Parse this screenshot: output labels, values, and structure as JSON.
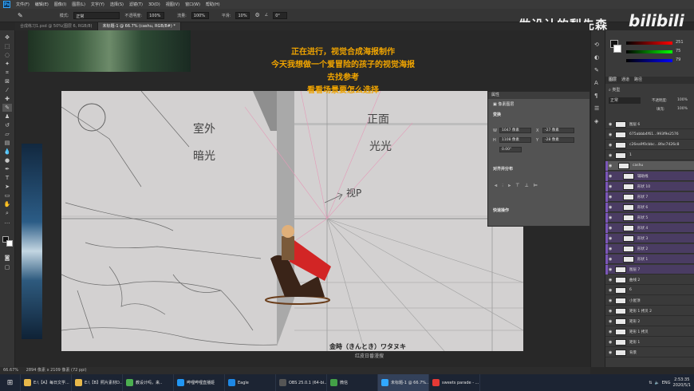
{
  "app": {
    "menu": [
      "文件(F)",
      "编辑(E)",
      "图像(I)",
      "图层(L)",
      "文字(Y)",
      "选择(S)",
      "滤镜(T)",
      "3D(D)",
      "视图(V)",
      "窗口(W)",
      "帮助(H)"
    ],
    "logo": "Ps"
  },
  "options_bar": {
    "mode_label": "模式:",
    "mode_value": "正常",
    "opacity_label": "不透明度:",
    "opacity_value": "100%",
    "flow_label": "流量:",
    "flow_value": "100%",
    "smooth_label": "平滑:",
    "smooth_value": "10%",
    "angle_value": "0°"
  },
  "tabs": [
    {
      "label": "合成练习1.psd @ 50%(图层 6, RGB/8)",
      "active": false
    },
    {
      "label": "未标题-1 @ 66.7% (cashu, RGB/8#) *",
      "active": true
    }
  ],
  "watermark": {
    "text": "做设计的梨先森",
    "logo": "bilibili"
  },
  "overlay_text": [
    "正在进行，视觉合成海报制作",
    "今天我想做一个爱冒险的孩子的视觉海报",
    "去找参考",
    "看看场景要怎么选择"
  ],
  "canvas": {
    "sketch_labels": [
      "室外",
      "暗光",
      "正面",
      "光光",
      "视P"
    ],
    "caption": "金時（きんとき）ワタヌキ",
    "caption_sub": "红皮日番漫搜"
  },
  "properties_panel": {
    "title": "属性",
    "layer_type": "像素图层",
    "transform_label": "变换",
    "w_label": "W",
    "w_value": "1047 像素",
    "x_label": "X",
    "x_value": "-27 像素",
    "h_label": "H",
    "h_value": "1108 像素",
    "y_label": "Y",
    "y_value": "-28 像素",
    "angle_value": "0.00°",
    "align_label": "对齐并分布",
    "quick_actions_label": "快速操作"
  },
  "color_panel": {
    "r_value": "251",
    "g_value": "75",
    "b_value": "79"
  },
  "layers_panel": {
    "tabs": [
      "图层",
      "通道",
      "路径"
    ],
    "kind_label": "类型",
    "blend_mode": "正常",
    "opacity_label": "不透明度:",
    "opacity_value": "100%",
    "fill_label": "填充:",
    "fill_value": "100%",
    "layers": [
      {
        "name": "图层 6",
        "selected": false
      },
      {
        "name": "675abbb4f61...993f9e2576",
        "selected": false
      },
      {
        "name": "c26ea9f0cbbc...8fac7426c8",
        "selected": false
      },
      {
        "name": "1",
        "selected": false
      },
      {
        "name": "cashu",
        "selected": true
      },
      {
        "name": "辅助线",
        "selected": false
      },
      {
        "name": "形状 10",
        "selected": false
      },
      {
        "name": "形状 7",
        "selected": false
      },
      {
        "name": "形状 6",
        "selected": false
      },
      {
        "name": "形状 5",
        "selected": false
      },
      {
        "name": "形状 4",
        "selected": false
      },
      {
        "name": "形状 3",
        "selected": false
      },
      {
        "name": "形状 2",
        "selected": false
      },
      {
        "name": "形状 1",
        "selected": false
      },
      {
        "name": "图层 7",
        "selected": false
      },
      {
        "name": "曲线 2",
        "selected": false
      },
      {
        "name": "6",
        "selected": false
      },
      {
        "name": "小屋顶",
        "selected": false
      },
      {
        "name": "矩形 1 拷贝 2",
        "selected": false
      },
      {
        "name": "矩形 2",
        "selected": false
      },
      {
        "name": "矩形 1 拷贝",
        "selected": false
      },
      {
        "name": "矩形 1",
        "selected": false
      },
      {
        "name": "背景",
        "selected": false
      }
    ]
  },
  "status_bar": {
    "zoom": "66.67%",
    "doc_size": "2894 像素 x 2109 像素 (72 ppi)"
  },
  "taskbar": {
    "items": [
      {
        "label": "E:\\【A】每日文学...",
        "color": "#e8b84a"
      },
      {
        "label": "E:\\【B】照片素材D...",
        "color": "#e8b84a"
      },
      {
        "label": "教设计吗，来..",
        "color": "#4caf50"
      },
      {
        "label": "哔哩哔哩直播姬",
        "color": "#2196f3"
      },
      {
        "label": "Eagle",
        "color": "#1e88e5"
      },
      {
        "label": "OBS 25.0.1 (64-bi...",
        "color": "#555555"
      },
      {
        "label": "微信",
        "color": "#43a047"
      },
      {
        "label": "未标题-1 @ 66.7%...",
        "color": "#31a8ff"
      },
      {
        "label": "sweets parade - ...",
        "color": "#e53935"
      }
    ],
    "lang": "ENG",
    "time": "2:53:35",
    "date": "2020/5/1"
  },
  "colors": {
    "accent_purple": "#7a56b8",
    "overlay_orange": "#f0a400",
    "cape_red": "#d22525",
    "ps_blue": "#31a8ff"
  }
}
